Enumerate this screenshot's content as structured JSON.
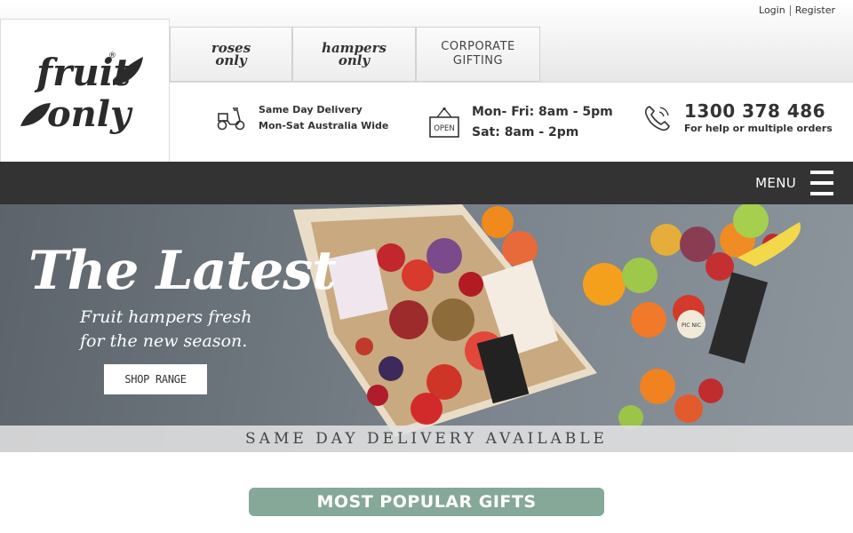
{
  "header": {
    "login_label": "Login",
    "register_label": "Register",
    "logo_text_line1": "fruit",
    "logo_text_line2": "only",
    "logo_reg": "®",
    "tabs": {
      "roses_line1": "roses",
      "roses_line2": "only",
      "hampers_line1": "hampers",
      "hampers_line2": "only",
      "corporate_line1": "CORPORATE",
      "corporate_line2": "GIFTING"
    }
  },
  "info": {
    "delivery_line1": "Same Day Delivery",
    "delivery_line2": "Mon-Sat Australia Wide",
    "open_sign": "OPEN",
    "hours_line1": "Mon- Fri: 8am - 5pm",
    "hours_line2": "Sat: 8am - 2pm",
    "phone_number": "1300 378 486",
    "phone_sub": "For help or multiple orders",
    "icons": [
      "scooter-icon",
      "open-sign-icon",
      "phone-icon"
    ]
  },
  "nav": {
    "menu_label": "MENU"
  },
  "hero": {
    "title": "The Latest",
    "subtitle_line1": "Fruit hampers fresh",
    "subtitle_line2": "for the new season.",
    "cta_label": "SHOP RANGE",
    "strip_text": "SAME DAY DELIVERY AVAILABLE",
    "picnic_tag": "PIC NIC"
  },
  "sections": {
    "popular_label": "MOST POPULAR GIFTS"
  },
  "colors": {
    "nav_bg": "#333333",
    "popular_bg": "#86a899",
    "hero_bg": "#6e767e"
  }
}
